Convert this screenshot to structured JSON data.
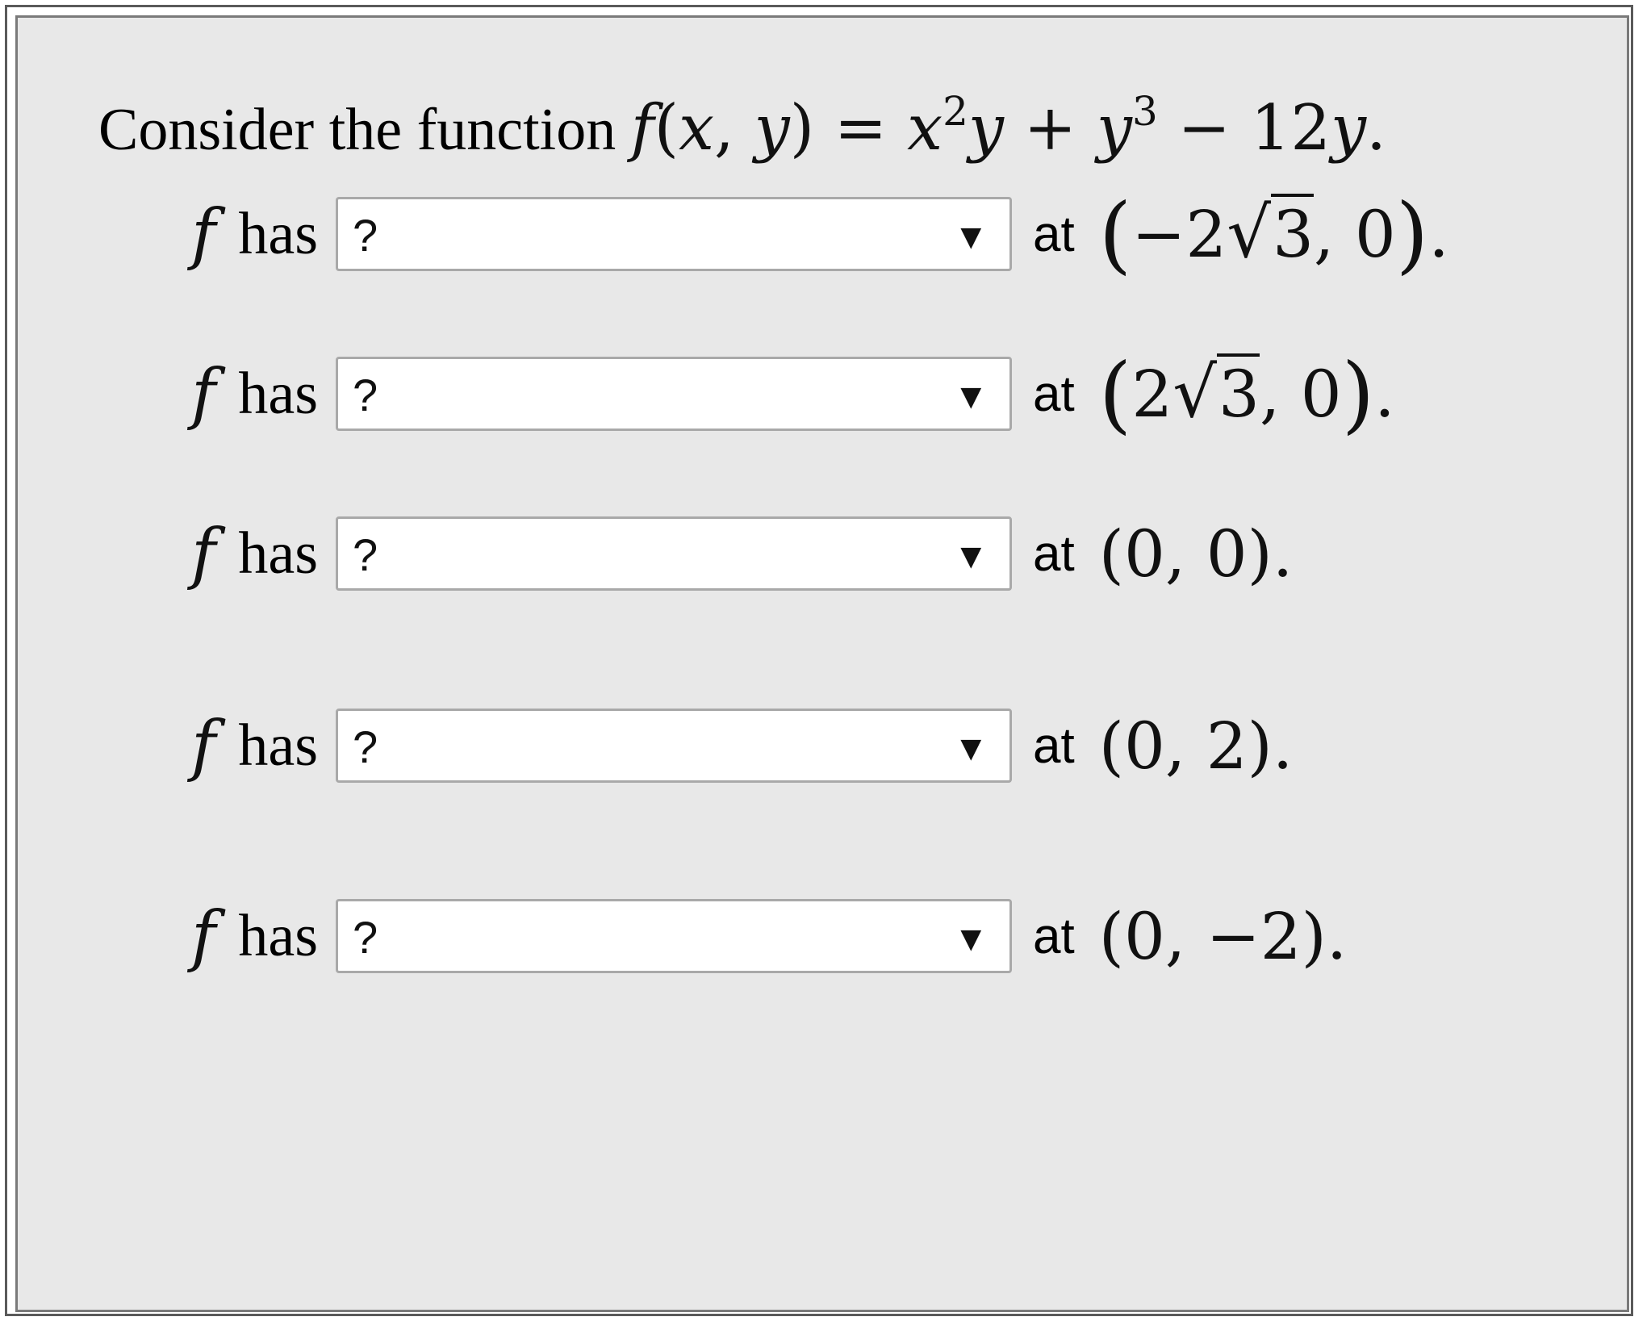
{
  "question": {
    "prefix": "Consider the function",
    "function_math": "f(x, y) = x²y + y³ − 12y."
  },
  "rows": [
    {
      "f_symbol": "f",
      "has_label": "has",
      "select_value": "?",
      "at_label": "at",
      "point_open": "(",
      "point_pre": "−2",
      "sqrt_symbol": "√",
      "sqrt_arg": "3",
      "point_post": ", 0",
      "point_close": ")",
      "terminator": "."
    },
    {
      "f_symbol": "f",
      "has_label": "has",
      "select_value": "?",
      "at_label": "at",
      "point_open": "(",
      "point_pre": "2",
      "sqrt_symbol": "√",
      "sqrt_arg": "3",
      "point_post": ", 0",
      "point_close": ")",
      "terminator": "."
    },
    {
      "f_symbol": "f",
      "has_label": "has",
      "select_value": "?",
      "at_label": "at",
      "point": "(0, 0).",
      "terminator": ""
    },
    {
      "f_symbol": "f",
      "has_label": "has",
      "select_value": "?",
      "at_label": "at",
      "point": "(0, 2).",
      "terminator": ""
    },
    {
      "f_symbol": "f",
      "has_label": "has",
      "select_value": "?",
      "at_label": "at",
      "point": "(0, −2).",
      "terminator": ""
    }
  ],
  "icons": {
    "dropdown_arrow": "dropdown-arrow-icon"
  }
}
